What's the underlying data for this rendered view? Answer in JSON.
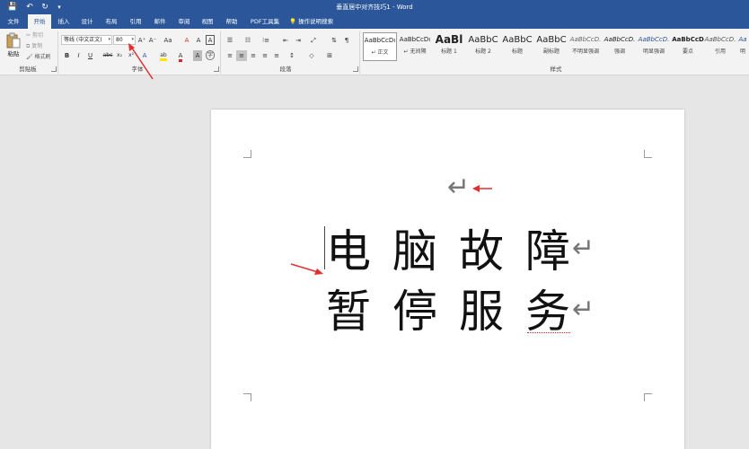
{
  "window": {
    "title": "垂直居中对齐技巧1 - Word",
    "quick_access": {
      "save": "💾",
      "undo": "↶",
      "redo": "↻",
      "customize": "▾"
    }
  },
  "tabs": [
    "文件",
    "开始",
    "插入",
    "设计",
    "布局",
    "引用",
    "邮件",
    "审阅",
    "视图",
    "帮助",
    "PDF工具集"
  ],
  "active_tab": "开始",
  "tell_me": "操作说明搜索",
  "clipboard": {
    "paste": "粘贴",
    "cut": "剪切",
    "copy": "复制",
    "format_painter": "格式刷",
    "group_label": "剪贴板"
  },
  "font": {
    "family": "等线 (中文正文)",
    "size": "80",
    "grow": "A⁺",
    "shrink": "A⁻",
    "case": "Aa",
    "clear": "A",
    "wen": "A",
    "bold": "B",
    "italic": "I",
    "underline": "U",
    "strike": "abc",
    "sub": "x₂",
    "sup": "x²",
    "effects": "A",
    "highlight": "ab",
    "color": "A",
    "shade": "A",
    "circle": "字",
    "group_label": "字体",
    "highlight_color": "#ffe500",
    "font_color": "#e02020"
  },
  "paragraph": {
    "group_label": "段落",
    "bullets": "☰",
    "numbering": "☷",
    "multilevel": "⁝≡",
    "dec_indent": "⇤",
    "inc_indent": "⇥",
    "cn_layout": "⤢",
    "sort": "⇅",
    "show_marks": "¶",
    "align_left": "≡",
    "align_center": "≡",
    "align_right": "≡",
    "justify": "≡",
    "distributed": "≡",
    "line_spacing": "↕",
    "shading": "◇",
    "borders": "⊞"
  },
  "styles": {
    "group_label": "样式",
    "items": [
      {
        "preview": "AaBbCcDı",
        "name": "↵ 正文"
      },
      {
        "preview": "AaBbCcDı",
        "name": "↵ 无间隔"
      },
      {
        "preview": "AaBl",
        "name": "标题 1"
      },
      {
        "preview": "AaBbC",
        "name": "标题 2"
      },
      {
        "preview": "AaBbC",
        "name": "标题"
      },
      {
        "preview": "AaBbC",
        "name": "副标题"
      },
      {
        "preview": "AaBbCcD.",
        "name": "不明显强调"
      },
      {
        "preview": "AaBbCcD.",
        "name": "强调"
      },
      {
        "preview": "AaBbCcD.",
        "name": "明显强调"
      },
      {
        "preview": "AaBbCcD",
        "name": "要点"
      },
      {
        "preview": "AaBbCcD.",
        "name": "引用"
      },
      {
        "preview": "Aa",
        "name": "明"
      }
    ]
  },
  "document": {
    "lines": [
      "电脑故障",
      "暂停服务"
    ],
    "paragraph_mark": "↵",
    "empty_para_mark": "↵"
  },
  "colors": {
    "brand": "#2b579a",
    "annotation": "#e03030"
  }
}
